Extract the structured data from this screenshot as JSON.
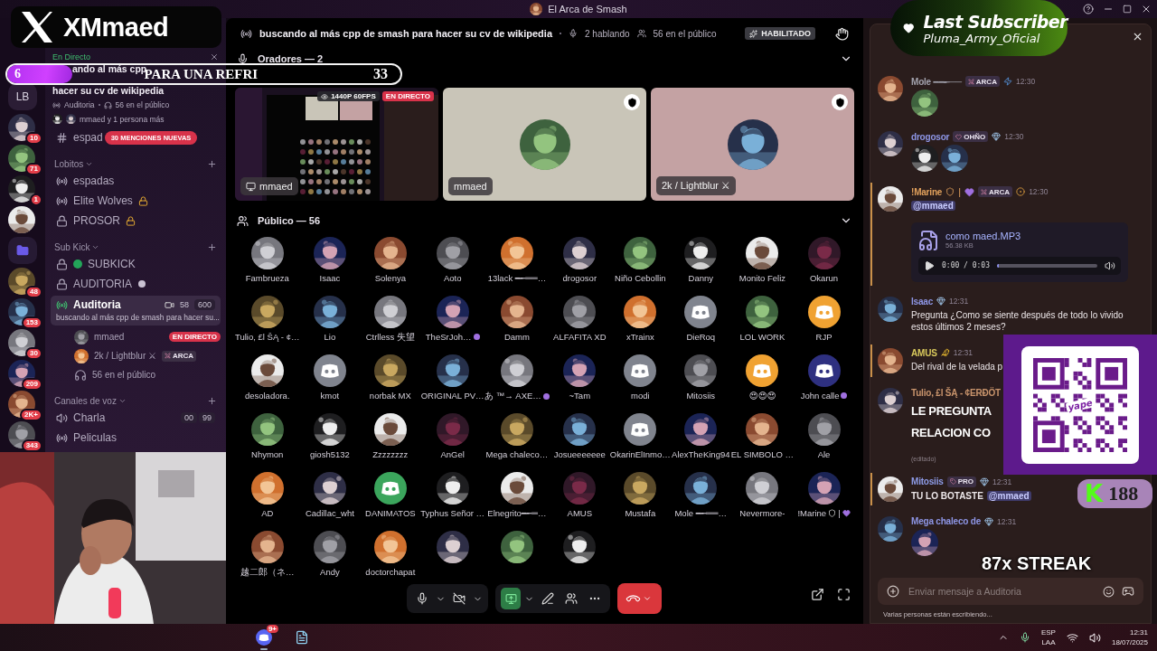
{
  "window": {
    "title": "El Arca de Smash"
  },
  "servers": [
    {
      "kind": "text",
      "label": "LB"
    },
    {
      "kind": "picture",
      "badge": "10"
    },
    {
      "kind": "picture",
      "badge": "71"
    },
    {
      "kind": "picture",
      "badge": "1"
    },
    {
      "kind": "picture"
    },
    {
      "kind": "folder"
    },
    {
      "kind": "picture",
      "badge": "48"
    },
    {
      "kind": "picture",
      "badge": "153"
    },
    {
      "kind": "picture",
      "badge": "30"
    },
    {
      "kind": "picture",
      "badge": "209"
    },
    {
      "kind": "picture",
      "badge": "2K+"
    },
    {
      "kind": "picture",
      "badge": "343"
    }
  ],
  "sidebar": {
    "live_panel": {
      "status": "En Directo",
      "title_lines": [
        "ando al más cpp",
        "hacer su cv de wikipedia"
      ],
      "channel": "Auditoria",
      "audience": "56 en el público",
      "participants": "mmaed y 1 persona más"
    },
    "top_channel": {
      "name": "espad",
      "mentions": "30 MENCIONES NUEVAS"
    },
    "categories": [
      {
        "name": "Lobitos",
        "channels": [
          {
            "kind": "stage",
            "name": "espadas",
            "locked": false,
            "selected": false
          },
          {
            "kind": "stage",
            "name": "Elite Wolves",
            "locked": true,
            "selected": false
          },
          {
            "kind": "private",
            "name": "PROSOR",
            "locked": true,
            "selected": false
          }
        ]
      },
      {
        "name": "Sub Kick",
        "channels": [
          {
            "kind": "private",
            "name": "SUBKICK",
            "locked": false,
            "selected": false,
            "color": "#23a559"
          },
          {
            "kind": "private",
            "name": "AUDITORIA",
            "locked": false,
            "selected": false
          },
          {
            "kind": "live_stage",
            "name": "Auditoria",
            "locked": false,
            "selected": true,
            "video_count": "58",
            "limit": "600",
            "subtitle": "buscando al más cpp de smash para hacer su...",
            "members": [
              {
                "kind": "user",
                "name": "mmaed",
                "badge": {
                  "kind": "live",
                  "text": "EN DIRECTO"
                }
              },
              {
                "kind": "user",
                "name": "2k / Lightblur ⚔",
                "badge": {
                  "kind": "role",
                  "text": "ARCA"
                }
              },
              {
                "kind": "audience",
                "name": "56 en el público"
              }
            ]
          }
        ]
      },
      {
        "name": "Canales de voz",
        "channels": [
          {
            "kind": "voice",
            "name": "Charla",
            "locked": false,
            "selected": false,
            "counts": [
              "00",
              "99"
            ]
          },
          {
            "kind": "stage",
            "name": "Peliculas",
            "locked": false,
            "selected": false
          }
        ]
      }
    ]
  },
  "stage": {
    "topic": "buscando al más cpp de smash para hacer su cv de wikipedia",
    "speaking": "2 hablando",
    "audience": "56 en el público",
    "status": "HABILITADO",
    "speakers": {
      "title": "Oradores — 2",
      "expanded": true,
      "tiles": [
        {
          "kind": "stream",
          "name": "mmaed",
          "quality": "1440P 60FPS",
          "live": "EN DIRECTO"
        },
        {
          "kind": "avatar",
          "name": "mmaed",
          "color": "#c9c5b8"
        },
        {
          "kind": "avatar",
          "name": "2k / Lightblur ⚔",
          "color": "#c4a2a3"
        }
      ]
    },
    "audience_section": {
      "title": "Público — 56",
      "expanded": true,
      "members": [
        {
          "name": "Fambrueza",
          "kind": "picture",
          "boosted": false
        },
        {
          "name": "Isaac",
          "kind": "picture",
          "boosted": false
        },
        {
          "name": "Solenya",
          "kind": "picture",
          "boosted": false
        },
        {
          "name": "Aoto",
          "kind": "picture",
          "boosted": false
        },
        {
          "name": "13lack ━╾══…",
          "kind": "picture",
          "boosted": false
        },
        {
          "name": "drogosor",
          "kind": "picture",
          "boosted": false
        },
        {
          "name": "Niño Cebollin",
          "kind": "picture",
          "boosted": false
        },
        {
          "name": "Danny",
          "kind": "picture",
          "boosted": false
        },
        {
          "name": "Monito Feliz",
          "kind": "picture",
          "boosted": false
        },
        {
          "name": "Okarun",
          "kind": "picture",
          "boosted": false
        },
        {
          "name": "Tulio, £l ŠĄ - ¢…",
          "kind": "picture",
          "boosted": false
        },
        {
          "name": "Lio",
          "kind": "picture",
          "boosted": false
        },
        {
          "name": "Ctrlless 失望",
          "kind": "picture",
          "boosted": false
        },
        {
          "name": "TheSrJoh…",
          "kind": "picture",
          "boosted": true
        },
        {
          "name": "Damm",
          "kind": "picture",
          "boosted": false
        },
        {
          "name": "ALFAFITA XD",
          "kind": "picture",
          "boosted": false
        },
        {
          "name": "xTrainx",
          "kind": "picture",
          "boosted": false
        },
        {
          "name": "DieRoq",
          "kind": "default",
          "color": "#80848e",
          "boosted": false
        },
        {
          "name": "LOL WORK",
          "kind": "picture",
          "boosted": false
        },
        {
          "name": "RJP",
          "kind": "default",
          "color": "#f0a232",
          "boosted": false
        },
        {
          "name": "desoladora.",
          "kind": "picture",
          "boosted": false
        },
        {
          "name": "kmot",
          "kind": "default",
          "color": "#80848e",
          "boosted": false
        },
        {
          "name": "norbak MX",
          "kind": "picture",
          "boosted": false
        },
        {
          "name": "ORIGINAL PV…",
          "kind": "picture",
          "boosted": false
        },
        {
          "name": "あ ™→ AXE…",
          "kind": "picture",
          "boosted": true
        },
        {
          "name": "~Tam",
          "kind": "picture",
          "boosted": false
        },
        {
          "name": "modi",
          "kind": "default",
          "color": "#80848e",
          "boosted": false
        },
        {
          "name": "Mitosiis",
          "kind": "picture",
          "boosted": false
        },
        {
          "name": "😍😍😍",
          "kind": "default",
          "color": "#f0a232",
          "boosted": false
        },
        {
          "name": "John calle",
          "kind": "default",
          "color": "#2e3080",
          "boosted": true
        },
        {
          "name": "Nhymon",
          "kind": "picture",
          "boosted": false
        },
        {
          "name": "giosh5132",
          "kind": "picture",
          "boosted": false
        },
        {
          "name": "Zzzzzzzz",
          "kind": "picture",
          "boosted": false
        },
        {
          "name": "AnGel",
          "kind": "picture",
          "boosted": false
        },
        {
          "name": "Mega chaleco…",
          "kind": "picture",
          "boosted": false
        },
        {
          "name": "Josueeeeeee",
          "kind": "picture",
          "boosted": false
        },
        {
          "name": "OkarinElInmo…",
          "kind": "default",
          "color": "#80848e",
          "boosted": false
        },
        {
          "name": "AlexTheKing94",
          "kind": "picture",
          "boosted": false
        },
        {
          "name": "EL SIMBOLO …",
          "kind": "picture",
          "boosted": false
        },
        {
          "name": "Ale",
          "kind": "picture",
          "boosted": false
        },
        {
          "name": "AD",
          "kind": "picture",
          "boosted": false
        },
        {
          "name": "Cadillac_wht",
          "kind": "picture",
          "boosted": false
        },
        {
          "name": "DANIMATOS",
          "kind": "default",
          "color": "#3ba55c",
          "boosted": false
        },
        {
          "name": "Typhus Señor …",
          "kind": "picture",
          "boosted": false
        },
        {
          "name": "Elnegrito━╾═…",
          "kind": "picture",
          "boosted": false
        },
        {
          "name": "AMUS",
          "kind": "picture",
          "boosted": false
        },
        {
          "name": "Mustafa",
          "kind": "picture",
          "boosted": false
        },
        {
          "name": "Mole ━╾══…",
          "kind": "picture",
          "boosted": false
        },
        {
          "name": "Nevermore-",
          "kind": "picture",
          "boosted": false
        },
        {
          "name": "!Marine",
          "flair": "|",
          "kind": "picture",
          "boosted": false
        },
        {
          "name": "越二郎（ネ…",
          "kind": "picture",
          "boosted": false
        },
        {
          "name": "Andy",
          "kind": "picture",
          "boosted": false
        },
        {
          "name": "doctorchapat",
          "kind": "picture",
          "boosted": false
        },
        {
          "kind": "picture",
          "boosted": false
        },
        {
          "kind": "picture",
          "boosted": false
        },
        {
          "kind": "picture",
          "boosted": false
        }
      ]
    },
    "call_controls": {
      "mic_on": true,
      "camera_on": false,
      "sharing": true
    }
  },
  "chat": {
    "messages": [
      {
        "author": "Mole ━━╾──",
        "color": "#a3a3ae",
        "tag": {
          "kind": "sword",
          "text": "ARCA"
        },
        "badge": {
          "kind": "bolt"
        },
        "time": "12:30",
        "mentioned": false,
        "media": [
          {
            "kind": "picture"
          }
        ]
      },
      {
        "author": "drogosor",
        "color": "#8e96e6",
        "tag": {
          "kind": "heart",
          "text": "OHÑO"
        },
        "badge": {
          "kind": "gem"
        },
        "time": "12:30",
        "mentioned": false,
        "media": [
          {
            "kind": "picture"
          },
          {
            "kind": "picture"
          }
        ]
      },
      {
        "author": "!Marine",
        "flair": "|",
        "color": "#e2a15c",
        "tag": {
          "kind": "sword",
          "text": "ARCA"
        },
        "badge": {
          "kind": "ring"
        },
        "time": "12:30",
        "mentioned": true,
        "parts": [
          {
            "kind": "mention",
            "text": "@mmaed"
          }
        ],
        "attachment": {
          "file": "como maed.MP3",
          "size": "56.38 KB",
          "time": "0:00 / 0:03",
          "level": 0.02
        }
      },
      {
        "author": "Isaac",
        "color": "#8e96e6",
        "badge": {
          "kind": "gem"
        },
        "time": "12:31",
        "mentioned": false,
        "parts": [
          {
            "kind": "text",
            "text": "Pregunta ¿Como se siente después de todo lo vivido estos últimos 2 meses?"
          }
        ]
      },
      {
        "author": "AMUS",
        "color": "#d9c95c",
        "badge": {
          "kind": "duck"
        },
        "time": "12:31",
        "mentioned": true,
        "parts": [
          {
            "kind": "text",
            "text": "Del rival de la velada p"
          }
        ]
      },
      {
        "author": "Tulio, £l ŠĄ - ¢ERĐÖT",
        "color": "#c9946c",
        "mentioned": false,
        "parts": [
          {
            "kind": "heading",
            "text": "LE PREGUNTA"
          },
          {
            "kind": "heading",
            "text": "RELACION CO"
          }
        ],
        "edited": "(editado)"
      },
      {
        "author": "Mitosiis",
        "color": "#8e9ce8",
        "tag": {
          "kind": "tag",
          "text": "PRO"
        },
        "badge": {
          "kind": "gem"
        },
        "time": "12:31",
        "mentioned": true,
        "parts": [
          {
            "kind": "bold",
            "text": "TU LO BOTASTE"
          },
          {
            "kind": "mention",
            "text": "@mmaed"
          }
        ]
      },
      {
        "author": "Mega chaleco de",
        "color": "#8e96e6",
        "badge": {
          "kind": "gem"
        },
        "time": "12:31",
        "mentioned": false,
        "media": [
          {
            "kind": "picture"
          }
        ]
      }
    ],
    "input": {
      "placeholder": "Enviar mensaje a Auditoria"
    },
    "typing": "Varias personas están escribiendo..."
  },
  "overlays": {
    "x_banner": {
      "handle": "XMmaed"
    },
    "goal": {
      "count": "6",
      "text": "PARA UNA REFRI",
      "total": "33",
      "level": 0.17
    },
    "subscriber": {
      "title": "Last Subscriber",
      "name": "Pluma_Army_Oficial"
    },
    "qr": {
      "brand": "yape"
    },
    "kick": {
      "logo": "K",
      "count": "188"
    },
    "streak": {
      "text": "87x STREAK"
    }
  },
  "taskbar": {
    "apps": [
      {
        "kind": "discord",
        "badge": "9+",
        "active": true
      },
      {
        "kind": "notepad",
        "active": false
      }
    ],
    "lang": [
      "ESP",
      "LAA"
    ],
    "time": "12:31",
    "date": "18/07/2025"
  }
}
